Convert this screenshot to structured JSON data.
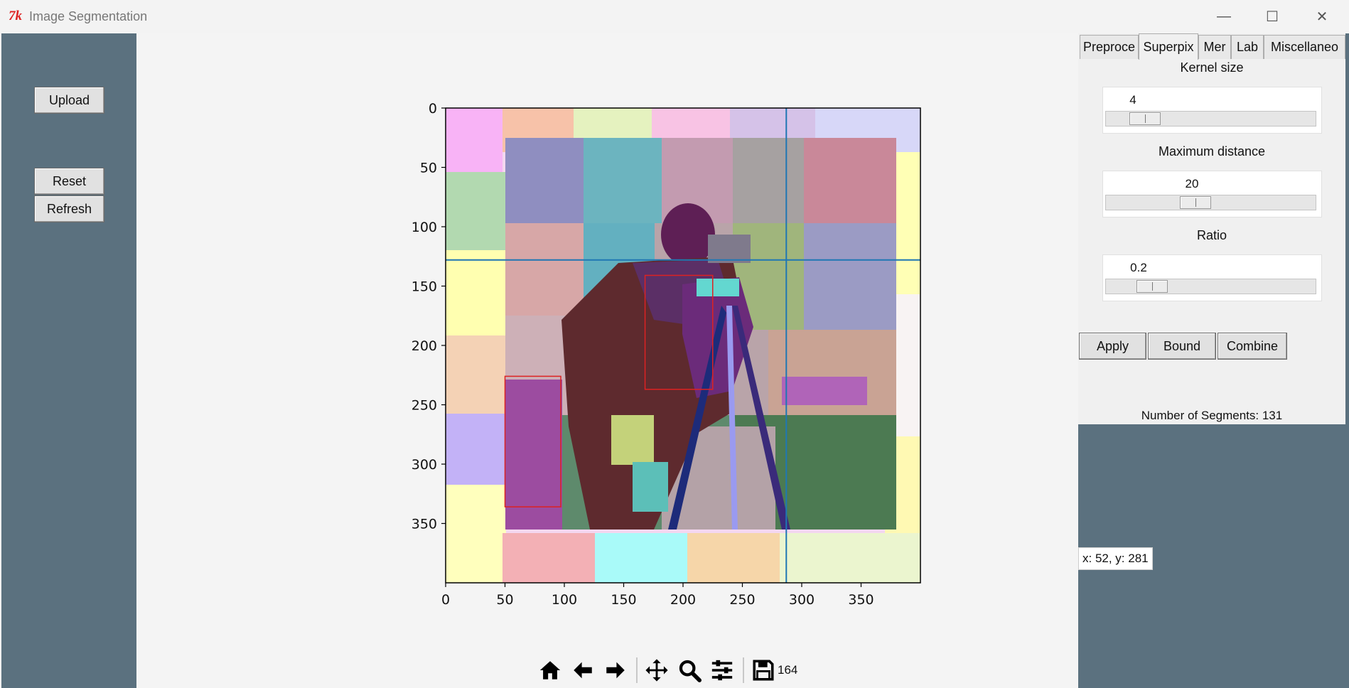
{
  "window": {
    "title": "Image Segmentation",
    "logo": "7k",
    "minimize": "—",
    "maximize": "☐",
    "close": "✕"
  },
  "left_panel": {
    "upload": "Upload",
    "reset": "Reset",
    "refresh": "Refresh"
  },
  "tabs": [
    "Preproce",
    "Superpix",
    "Mer",
    "Lab",
    "Miscellaneo"
  ],
  "active_tab": 1,
  "superpixel": {
    "kernel_label": "Kernel size",
    "kernel_value": "4",
    "kernel_fraction": 0.13,
    "distance_label": "Maximum distance",
    "distance_value": "20",
    "distance_fraction": 0.41,
    "ratio_label": "Ratio",
    "ratio_value": "0.2",
    "ratio_fraction": 0.17,
    "apply": "Apply",
    "bound": "Bound",
    "combine": "Combine",
    "segments": "Number of Segments: 131"
  },
  "coord_readout": "x: 52, y: 281",
  "plot": {
    "x_ticks": [
      "0",
      "50",
      "100",
      "150",
      "200",
      "250",
      "300",
      "350"
    ],
    "y_ticks": [
      "0",
      "50",
      "100",
      "150",
      "200",
      "250",
      "300",
      "350"
    ],
    "x_range": [
      0,
      400
    ],
    "y_range": [
      0,
      400
    ],
    "crosshair": {
      "x": 287,
      "y": 128
    },
    "rectangles": [
      {
        "x": 168,
        "y": 141,
        "w": 57,
        "h": 96
      },
      {
        "x": 50,
        "y": 226,
        "w": 47,
        "h": 110
      }
    ],
    "colors": {
      "crosshair": "#1f77b4",
      "rect": "#dd2222"
    }
  },
  "toolbar": {
    "icons": [
      "home-icon",
      "back-arrow-icon",
      "forward-arrow-icon",
      "pan-icon",
      "zoom-icon",
      "configure-icon",
      "save-icon"
    ],
    "number": "164"
  }
}
